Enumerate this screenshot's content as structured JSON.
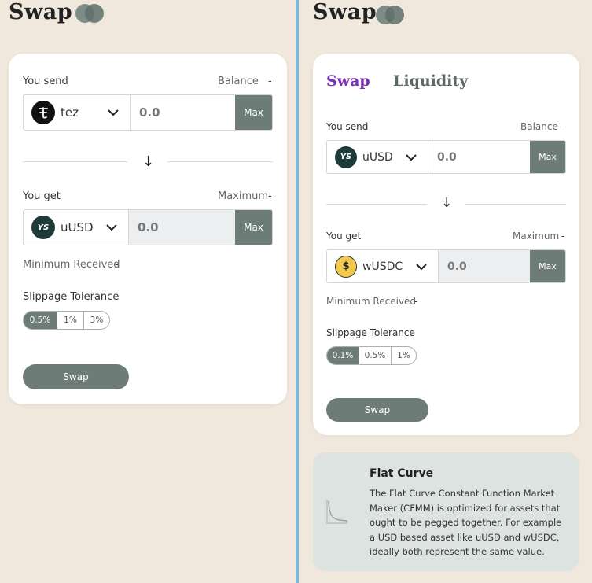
{
  "left": {
    "title": "Swap",
    "send": {
      "label": "You send",
      "balance_label": "Balance",
      "balance_value": "-",
      "token": "tez",
      "amount_placeholder": "0.0",
      "max": "Max"
    },
    "arrow": "↓",
    "get": {
      "label": "You get",
      "maximum_label": "Maximum",
      "maximum_value": "-",
      "token": "uUSD",
      "amount_placeholder": "0.0",
      "max": "Max"
    },
    "min_received_label": "Minimum Received",
    "min_received_value": "-",
    "slippage_label": "Slippage Tolerance",
    "slippage_options": [
      "0.5%",
      "1%",
      "3%"
    ],
    "slippage_selected": "0.5%",
    "swap_button": "Swap"
  },
  "right": {
    "title": "Swap",
    "tabs": [
      "Swap",
      "Liquidity"
    ],
    "active_tab": "Swap",
    "send": {
      "label": "You send",
      "balance_label": "Balance",
      "balance_value": "-",
      "token": "uUSD",
      "amount_placeholder": "0.0",
      "max": "Max"
    },
    "arrow": "↓",
    "get": {
      "label": "You get",
      "maximum_label": "Maximum",
      "maximum_value": "-",
      "token": "wUSDC",
      "amount_placeholder": "0.0",
      "max": "Max"
    },
    "min_received_label": "Minimum Received",
    "min_received_value": "-",
    "slippage_label": "Slippage Tolerance",
    "slippage_options": [
      "0.1%",
      "0.5%",
      "1%"
    ],
    "slippage_selected": "0.1%",
    "swap_button": "Swap",
    "info": {
      "title": "Flat Curve",
      "text": "The Flat Curve Constant Function Market Maker (CFMM) is optimized for assets that ought to be pegged together. For example a USD based asset like uUSD and wUSDC, ideally both represent the same value."
    }
  },
  "colors": {
    "background": "#f0e8dc",
    "accent_purple": "#7a2fb5",
    "button_gray": "#6e7c78",
    "divider_blue": "#7fb8d6",
    "info_card": "#dde3e1"
  },
  "icons": [
    "tezos-icon",
    "uusd-icon",
    "wusdc-icon",
    "chevron-down-icon",
    "arrow-down-icon",
    "flat-curve-icon",
    "logo-icon"
  ]
}
